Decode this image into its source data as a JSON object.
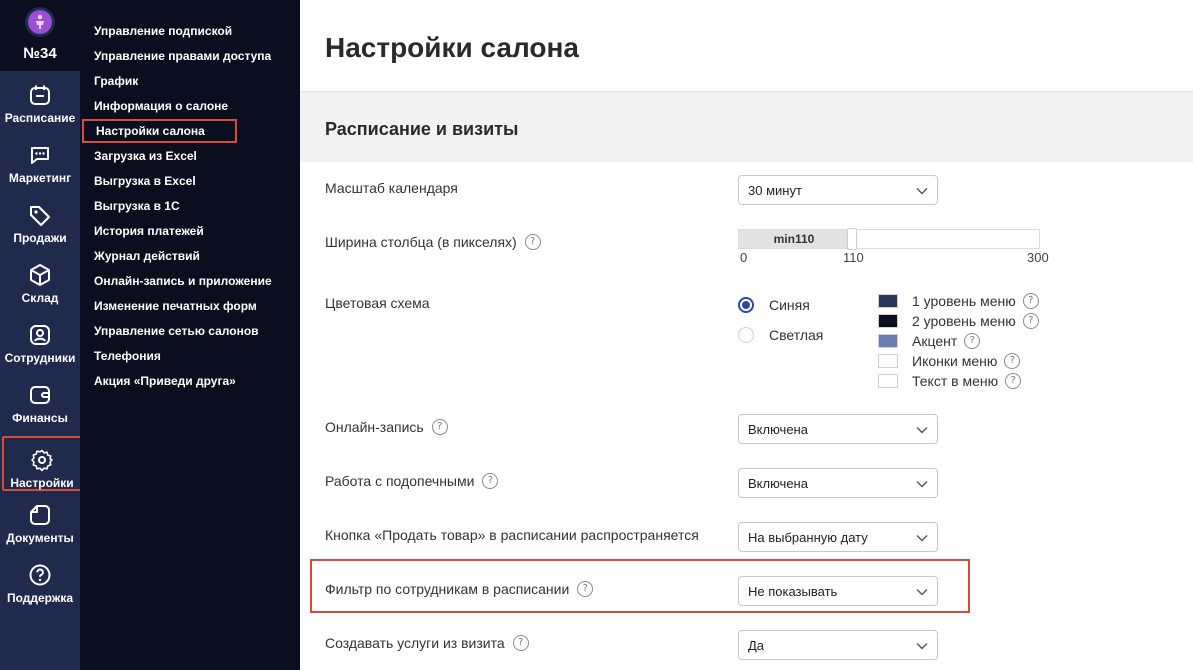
{
  "salon": {
    "number": "№34"
  },
  "rail": {
    "items": [
      {
        "label": "Расписание"
      },
      {
        "label": "Маркетинг"
      },
      {
        "label": "Продажи"
      },
      {
        "label": "Склад"
      },
      {
        "label": "Сотрудники"
      },
      {
        "label": "Финансы"
      },
      {
        "label": "Настройки"
      },
      {
        "label": "Документы"
      },
      {
        "label": "Поддержка"
      }
    ]
  },
  "submenu": {
    "items": [
      {
        "label": "Управление подпиской"
      },
      {
        "label": "Управление правами доступа"
      },
      {
        "label": "График"
      },
      {
        "label": "Информация о салоне"
      },
      {
        "label": "Настройки салона"
      },
      {
        "label": "Загрузка из Excel"
      },
      {
        "label": "Выгрузка в Excel"
      },
      {
        "label": "Выгрузка в 1С"
      },
      {
        "label": "История платежей"
      },
      {
        "label": "Журнал действий"
      },
      {
        "label": "Онлайн-запись и приложение"
      },
      {
        "label": "Изменение печатных форм"
      },
      {
        "label": "Управление сетью салонов"
      },
      {
        "label": "Телефония"
      },
      {
        "label": "Акция «Приведи друга»"
      }
    ]
  },
  "main": {
    "title": "Настройки салона",
    "section_title": "Расписание и визиты",
    "settings": {
      "calendar_scale": {
        "label": "Масштаб календаря",
        "value": "30 минут"
      },
      "column_width": {
        "label": "Ширина столбца (в пикселях)",
        "slider_text": "min110",
        "min": "0",
        "current": "110",
        "max": "300",
        "value_fraction": 0.3667
      },
      "color_scheme": {
        "label": "Цветовая схема",
        "options": [
          {
            "label": "Синяя",
            "selected": true
          },
          {
            "label": "Светлая",
            "selected": false
          }
        ],
        "swatches": [
          {
            "label": "1 уровень меню",
            "color": "#2b3459"
          },
          {
            "label": "2 уровень меню",
            "color": "#0a0e1f"
          },
          {
            "label": "Акцент",
            "color": "#6a7eb6"
          },
          {
            "label": "Иконки меню",
            "color": "#ffffff"
          },
          {
            "label": "Текст в меню",
            "color": "#ffffff"
          }
        ]
      },
      "online_booking": {
        "label": "Онлайн-запись",
        "value": "Включена"
      },
      "wards": {
        "label": "Работа с подопечными",
        "value": "Включена"
      },
      "sell_button": {
        "label": "Кнопка «Продать товар» в расписании распространяется",
        "value": "На выбранную дату"
      },
      "staff_filter": {
        "label": "Фильтр по сотрудникам в расписании",
        "value": "Не показывать"
      },
      "create_services": {
        "label": "Создавать услуги из визита",
        "value": "Да"
      }
    }
  },
  "colors": {
    "highlight": "#d64b3a",
    "accent": "#2b4aa0",
    "rail_bg": "#1f2a4d",
    "submenu_bg": "#0a0e1f"
  }
}
